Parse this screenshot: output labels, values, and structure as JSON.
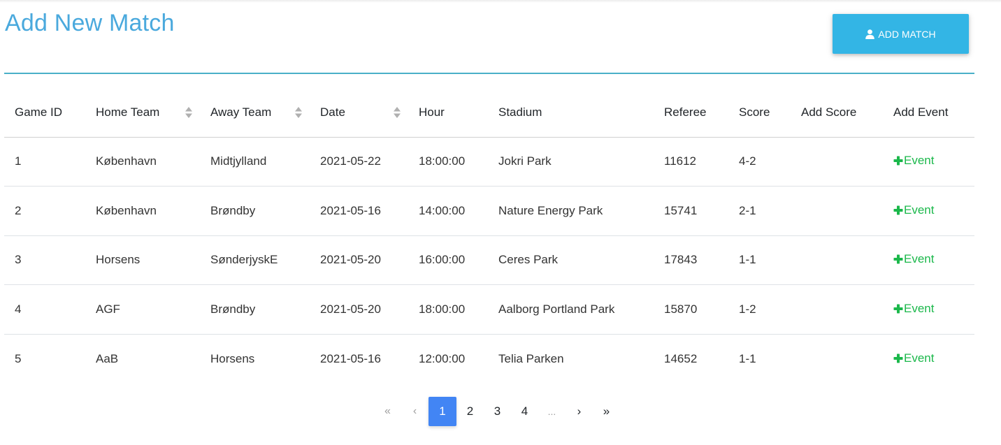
{
  "page": {
    "title": "Add New Match"
  },
  "toolbar": {
    "add_match_label": "ADD MATCH",
    "add_match_icon": "user-icon"
  },
  "colors": {
    "title": "#4aa9dd",
    "button": "#33b5e5",
    "rule": "#4ab0c8",
    "event": "#1bb84b",
    "active_page": "#4285f4"
  },
  "table": {
    "headers": {
      "game_id": "Game ID",
      "home_team": "Home Team",
      "away_team": "Away Team",
      "date": "Date",
      "hour": "Hour",
      "stadium": "Stadium",
      "referee": "Referee",
      "score": "Score",
      "add_score": "Add Score",
      "add_event": "Add Event"
    },
    "rows": [
      {
        "id": "1",
        "home": "København",
        "away": "Midtjylland",
        "date": "2021-05-22",
        "hour": "18:00:00",
        "stadium": "Jokri Park",
        "referee": "11612",
        "score": "4-2",
        "add_score": "",
        "event_label": "Event"
      },
      {
        "id": "2",
        "home": "København",
        "away": "Brøndby",
        "date": "2021-05-16",
        "hour": "14:00:00",
        "stadium": "Nature Energy Park",
        "referee": "15741",
        "score": "2-1",
        "add_score": "",
        "event_label": "Event"
      },
      {
        "id": "3",
        "home": "Horsens",
        "away": "SønderjyskE",
        "date": "2021-05-20",
        "hour": "16:00:00",
        "stadium": "Ceres Park",
        "referee": "17843",
        "score": "1-1",
        "add_score": "",
        "event_label": "Event"
      },
      {
        "id": "4",
        "home": "AGF",
        "away": "Brøndby",
        "date": "2021-05-20",
        "hour": "18:00:00",
        "stadium": "Aalborg Portland Park",
        "referee": "15870",
        "score": "1-2",
        "add_score": "",
        "event_label": "Event"
      },
      {
        "id": "5",
        "home": "AaB",
        "away": "Horsens",
        "date": "2021-05-16",
        "hour": "12:00:00",
        "stadium": "Telia Parken",
        "referee": "14652",
        "score": "1-1",
        "add_score": "",
        "event_label": "Event"
      }
    ]
  },
  "pagination": {
    "first": "«",
    "prev": "‹",
    "pages": [
      "1",
      "2",
      "3",
      "4"
    ],
    "active_page": "1",
    "ellipsis": "...",
    "next": "›",
    "last": "»"
  }
}
